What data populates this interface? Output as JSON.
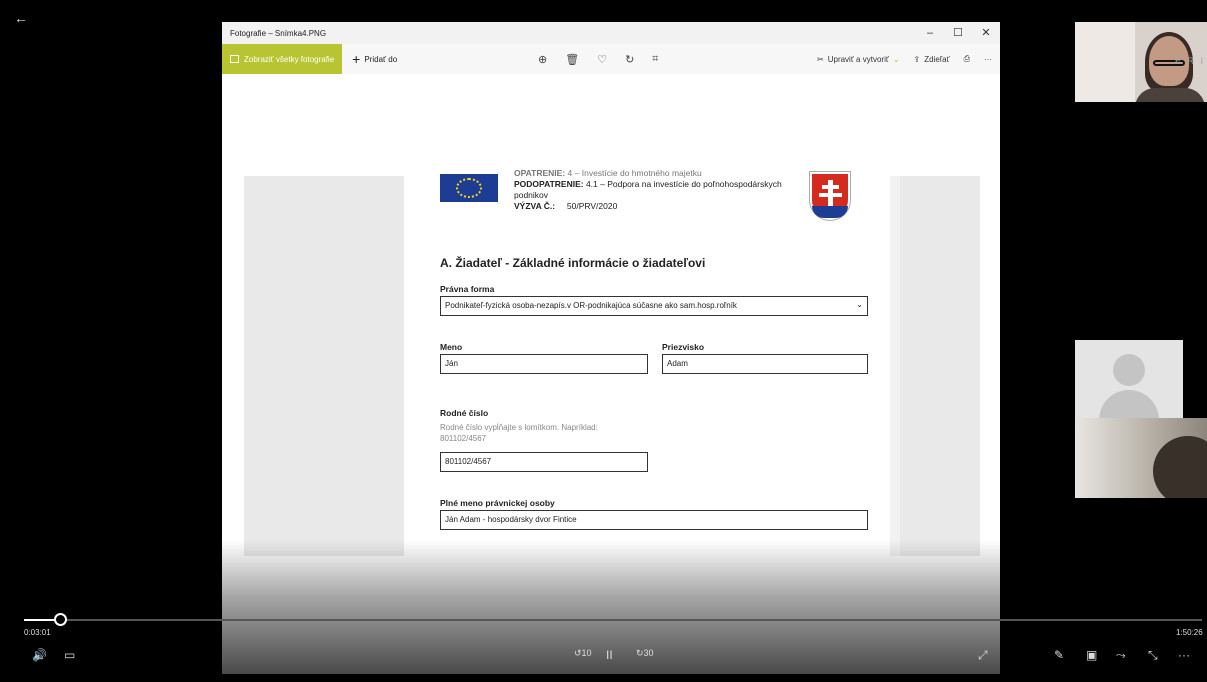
{
  "app": {
    "window_title": "Fotografie – Snímka4.PNG",
    "window_controls": {
      "minimize": "–",
      "maximize": "☐",
      "close": "✕"
    },
    "back_icon": "arrow-left-icon"
  },
  "toolbar": {
    "view_all": "Zobraziť všetky fotografie",
    "add_to": "Pridať do",
    "zoom": "⊕",
    "delete": "🗑",
    "favorite": "♡",
    "rotate": "↻",
    "crop": "⌗",
    "edit_create": "Upraviť a vytvoriť",
    "share": "Zdieľať",
    "print": "⎙",
    "more": "···",
    "accent_color": "#b8c431"
  },
  "document": {
    "header": {
      "line1_label": "OPATRENIE:",
      "line1_value": "4 – Investície do hmotného majetku",
      "line2_label": "PODOPATRENIE:",
      "line2_value": "4.1 – Podpora na investície do poľnohospodárskych podnikov",
      "line3_label": "VÝZVA Č.:",
      "line3_value": "50/PRV/2020"
    },
    "section_title": "A. Žiadateľ - Základné informácie o žiadateľovi",
    "legal_form_label": "Právna forma",
    "legal_form_value": "Podnikateľ-fyzická osoba-nezapís.v OR-podnikajúca súčasne ako sam.hosp.roľník",
    "first_name_label": "Meno",
    "first_name_value": "Ján",
    "last_name_label": "Priezvisko",
    "last_name_value": "Adam",
    "birth_number_label": "Rodné číslo",
    "birth_number_hint": "Rodné číslo vypĺňajte s lomítkom. Napríklad: 801102/4567",
    "birth_number_value": "801102/4567",
    "legal_name_label": "Plné meno právnickej osoby",
    "legal_name_value": "Ján Adam - hospodársky dvor Fintice"
  },
  "player": {
    "time_elapsed": "0:03:01",
    "time_total": "1:50:26",
    "progress": 0.027,
    "volume_icon": "🔊",
    "subtitles_icon": "▭",
    "rewind_label": "10",
    "pause_icon": "II",
    "forward_label": "30",
    "fullscreen_icon": "⤢",
    "pen_icon": "✎",
    "cast_icon": "▣",
    "skip_icon": "⤳",
    "minimize_icon": "⤡",
    "more_icon": "···"
  },
  "participants": {
    "tile1_text": "E R I"
  }
}
